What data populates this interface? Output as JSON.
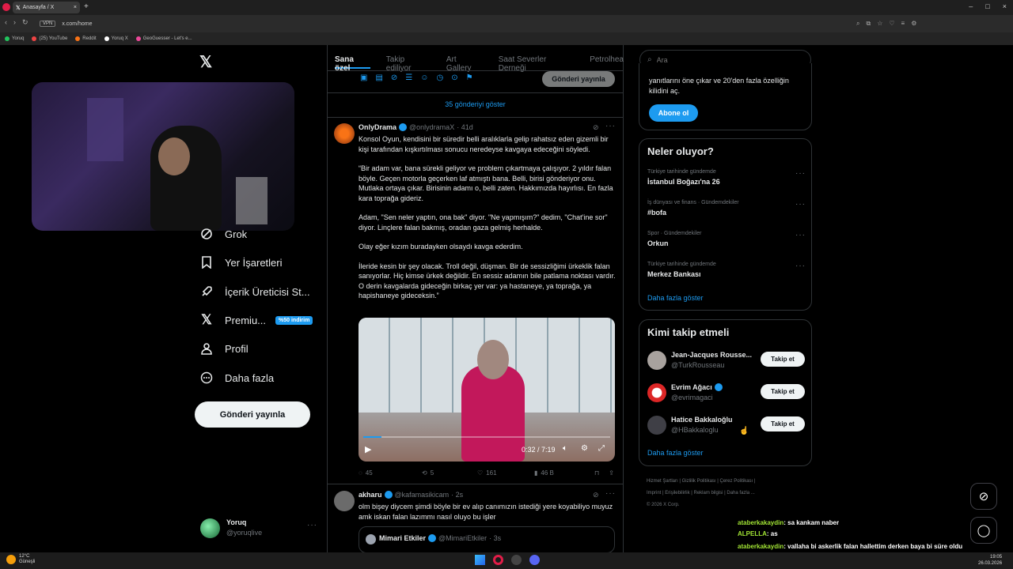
{
  "browser": {
    "tab_title": "Anasayfa / X",
    "url": "x.com/home",
    "vpn_label": "VPN",
    "bookmarks": [
      {
        "label": "Yoruq",
        "color": "#22c55e"
      },
      {
        "label": "(25) YouTube",
        "color": "#ef4444"
      },
      {
        "label": "Reddit",
        "color": "#f97316"
      },
      {
        "label": "Yoruq X",
        "color": "#ffffff"
      },
      {
        "label": "GeoGuesser - Let's e...",
        "color": "#ec4899"
      }
    ]
  },
  "nav": {
    "items": [
      {
        "label": "Grok",
        "icon": "grok-icon"
      },
      {
        "label": "Yer İşaretleri",
        "icon": "bookmark-icon"
      },
      {
        "label": "İçerik Üreticisi St...",
        "icon": "rocket-icon"
      },
      {
        "label": "Premiu...",
        "icon": "x-logo-icon"
      },
      {
        "label": "Profil",
        "icon": "profile-icon"
      },
      {
        "label": "Daha fazla",
        "icon": "more-circle-icon"
      }
    ],
    "premium_badge": "%50 indirim",
    "post_button": "Gönderi yayınla",
    "user": {
      "name": "Yoruq",
      "handle": "@yoruqlive"
    }
  },
  "feed": {
    "tabs": [
      "Sana özel",
      "Takip ediliyor",
      "Art Gallery",
      "Saat Severler Derneği",
      "Petrolhea"
    ],
    "compose_button": "Gönderi yayınla",
    "show_more": "35 gönderiyi göster",
    "tweet1": {
      "name": "OnlyDrama",
      "handle": "@onlydramaX",
      "time": "· 41d",
      "paragraphs": [
        "Konsol Oyun, kendisini bir süredir belli aralıklarla gelip rahatsız eden gizemli bir kişi tarafından kışkırtılması sonucu neredeyse kavgaya edeceğini söyledi.",
        "“Bir adam var, bana sürekli geliyor ve problem çıkartmaya çalışıyor. 2 yıldır falan böyle. Geçen motorla geçerken laf atmıştı bana. Belli, birisi gönderiyor onu. Mutlaka ortaya çıkar. Birisinin adamı o, belli zaten. Hakkımızda hayırlısı. En fazla kara toprağa gideriz.",
        "Adam, \"Sen neler yaptın, ona bak\" diyor. \"Ne yapmışım?\" dedim, \"Chat'ine sor\" diyor. Linçlere falan bakmış, oradan gaza gelmiş herhalde.",
        "Olay eğer kızım buradayken olsaydı kavga ederdim.",
        "İleride kesin bir şey olacak. Troll değil, düşman. Bir de sessizliğimi ürkeklik falan sanıyorlar. Hiç kimse ürkek değildir. En sessiz adamın bile patlama noktası vardır. O derin kavgalarda gideceğin birkaç yer var: ya hastaneye, ya toprağa, ya hapishaneye gideceksin.”"
      ],
      "video_time": "0:32 / 7:19",
      "video_progress": 0.073,
      "stats": {
        "replies": "45",
        "reposts": "5",
        "likes": "161",
        "views": "46 B"
      }
    },
    "tweet2": {
      "name": "akharu",
      "handle": "@kafamasikicam",
      "time": "· 2s",
      "text": "olm bişey diycem şimdi böyle bir ev alıp canımızın istediği yere koyabiliyo muyuz amk iskan falan lazımmı nasıl oluyo bu işler",
      "quote": {
        "name": "Mimari Etkiler",
        "handle": "@MimariEtkiler",
        "time": "· 3s"
      }
    }
  },
  "right": {
    "search_placeholder": "Ara",
    "premium": {
      "text": "yanıtlarını öne çıkar ve 20'den fazla özelliğin kilidini aç.",
      "button": "Abone ol"
    },
    "trends": {
      "title": "Neler oluyor?",
      "items": [
        {
          "cat": "Türkiye tarihinde gündemde",
          "name": "İstanbul Boğazı'na 26"
        },
        {
          "cat": "İş dünyası ve finans · Gündemdekiler",
          "name": "#bofa"
        },
        {
          "cat": "Spor · Gündemdekiler",
          "name": "Orkun"
        },
        {
          "cat": "Türkiye tarihinde gündemde",
          "name": "Merkez Bankası"
        }
      ],
      "more": "Daha fazla göster"
    },
    "follow": {
      "title": "Kimi takip etmeli",
      "items": [
        {
          "name": "Jean-Jacques Rousse...",
          "handle": "@TurkRousseau",
          "verified": false
        },
        {
          "name": "Evrim Ağacı",
          "handle": "@evrimagaci",
          "verified": true
        },
        {
          "name": "Hatice Bakkaloğlu",
          "handle": "@HBakkaloglu",
          "verified": false
        }
      ],
      "button": "Takip et",
      "more": "Daha fazla göster"
    },
    "footer": [
      "Hizmet Şartları",
      "Gizlilik Politikası",
      "Çerez Politikası",
      "Imprint",
      "Erişilebilirlik",
      "Reklam bilgisi",
      "Daha fazla ...",
      "© 2026 X Corp."
    ]
  },
  "chat": [
    {
      "user": "ataberkakaydin",
      "msg": ": sa kankam naber"
    },
    {
      "user": "ALPELLA",
      "msg": ": as"
    },
    {
      "user": "ataberkakaydin",
      "msg": ": vallaha bi askerlik falan hallettim derken baya bi süre oldu buralara takılmayalı kankam"
    }
  ],
  "taskbar": {
    "weather_temp": "12°C",
    "weather_label": "Güneşli",
    "time": "19:05",
    "date": "26.03.2026"
  }
}
